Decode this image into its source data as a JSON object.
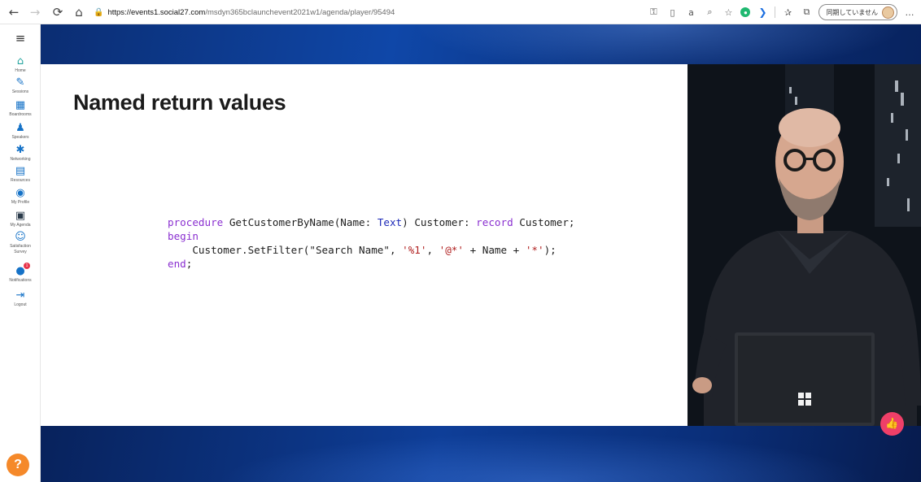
{
  "browser": {
    "back_icon": "←",
    "forward_icon": "→",
    "refresh_icon": "⟳",
    "home_icon": "⌂",
    "lock_icon": "🔒",
    "url_host": "https://events1.social27.com",
    "url_path": "/msdyn365bclaunchevent2021w1/agenda/player/95494",
    "sync_label": "同期していません",
    "more_icon": "…"
  },
  "sidebar": {
    "menu_icon": "≡",
    "items": [
      {
        "label": "Home",
        "icon": "⌂"
      },
      {
        "label": "Sessions",
        "icon": "✎"
      },
      {
        "label": "Boardrooms",
        "icon": "▦"
      },
      {
        "label": "Speakers",
        "icon": "♟"
      },
      {
        "label": "Networking",
        "icon": "✱"
      },
      {
        "label": "Resources",
        "icon": "▤"
      },
      {
        "label": "My Profile",
        "icon": "◉"
      },
      {
        "label": "My Agenda",
        "icon": "▣"
      },
      {
        "label": "Satisfaction",
        "label2": "Survey",
        "icon": "☺"
      },
      {
        "label": "Notifications",
        "icon": "●",
        "badge": "1"
      },
      {
        "label": "Logout",
        "icon": "⇥"
      }
    ],
    "help_label": "?"
  },
  "slide": {
    "title": "Named return values",
    "code": {
      "l1_kw1": "procedure",
      "l1_a": " GetCustomerByName(Name: ",
      "l1_ty": "Text",
      "l1_b": ") Customer: ",
      "l1_kw2": "record",
      "l1_c": " Customer;",
      "l2_kw": "begin",
      "l3_a": "    Customer.SetFilter(\"Search Name\", ",
      "l3_s1": "'%1'",
      "l3_b": ", ",
      "l3_s2": "'@*'",
      "l3_c": " + Name + ",
      "l3_s3": "'*'",
      "l3_d": ");",
      "l4_kw": "end",
      "l4_a": ";"
    }
  },
  "like_icon": "👍",
  "colors": {
    "accent_blue": "#1572c7",
    "banner_blue": "#0d3a8f",
    "help_orange": "#f5892a",
    "like_pink": "#ef3f68",
    "keyword_purple": "#8a2fd0",
    "string_red": "#b02020",
    "type_blue": "#1e2ab8"
  }
}
